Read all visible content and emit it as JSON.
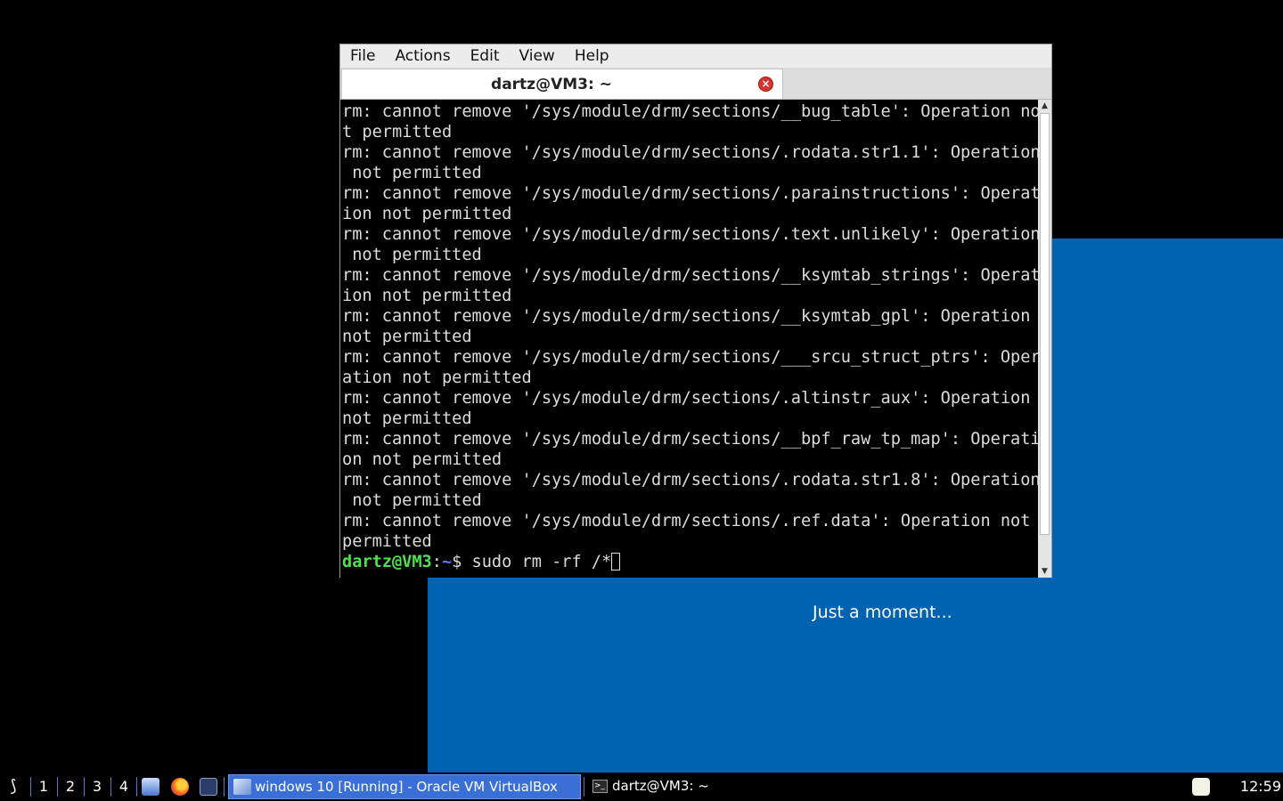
{
  "guest_window": {
    "loading_text": "Just a moment...",
    "background_color": "#0063b1"
  },
  "terminal": {
    "menu": [
      "File",
      "Actions",
      "Edit",
      "View",
      "Help"
    ],
    "tab_title": "dartz@VM3: ~",
    "output_lines": [
      "rm: cannot remove '/sys/module/drm/sections/__bug_table': Operation no",
      "t permitted",
      "rm: cannot remove '/sys/module/drm/sections/.rodata.str1.1': Operation",
      " not permitted",
      "rm: cannot remove '/sys/module/drm/sections/.parainstructions': Operat",
      "ion not permitted",
      "rm: cannot remove '/sys/module/drm/sections/.text.unlikely': Operation",
      " not permitted",
      "rm: cannot remove '/sys/module/drm/sections/__ksymtab_strings': Operat",
      "ion not permitted",
      "rm: cannot remove '/sys/module/drm/sections/__ksymtab_gpl': Operation",
      "not permitted",
      "rm: cannot remove '/sys/module/drm/sections/___srcu_struct_ptrs': Oper",
      "ation not permitted",
      "rm: cannot remove '/sys/module/drm/sections/.altinstr_aux': Operation",
      "not permitted",
      "rm: cannot remove '/sys/module/drm/sections/__bpf_raw_tp_map': Operati",
      "on not permitted",
      "rm: cannot remove '/sys/module/drm/sections/.rodata.str1.8': Operation",
      " not permitted",
      "rm: cannot remove '/sys/module/drm/sections/.ref.data': Operation not",
      "permitted"
    ],
    "prompt": {
      "user_host": "dartz@VM3",
      "separator": ":",
      "path": "~",
      "symbol": "$ ",
      "command": "sudo rm -rf /*"
    }
  },
  "taskbar": {
    "workspaces": [
      "1",
      "2",
      "3",
      "4"
    ],
    "launchers": [
      "file-manager-icon",
      "firefox-icon",
      "terminal-launcher-icon"
    ],
    "tasks": {
      "vbox": "windows 10 [Running] - Oracle VM VirtualBox",
      "terminal": "dartz@VM3: ~"
    },
    "clock": "12:59",
    "active_task_color": "#3a6fd8"
  }
}
